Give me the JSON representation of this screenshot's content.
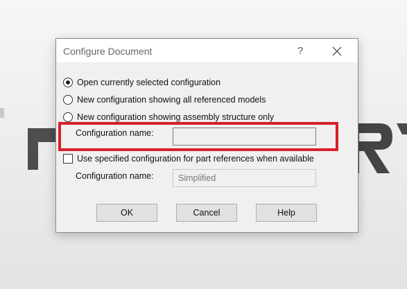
{
  "dialog": {
    "title": "Configure Document",
    "help_glyph": "?",
    "options": [
      {
        "label": "Open currently selected configuration",
        "selected": true
      },
      {
        "label": "New configuration showing all referenced models",
        "selected": false
      },
      {
        "label": "New configuration showing assembly structure only",
        "selected": false
      }
    ],
    "config_name_label": "Configuration name:",
    "config_name_value": "",
    "use_specified_label": "Use specified configuration for part references when available",
    "use_specified_checked": false,
    "specified_name_label": "Configuration name:",
    "specified_name_value": "Simplified",
    "buttons": {
      "ok": "OK",
      "cancel": "Cancel",
      "help": "Help"
    }
  },
  "colors": {
    "highlight": "#d81f26",
    "dialog_bg": "#f0f0f0"
  },
  "icons": [
    "close-icon",
    "help-icon"
  ]
}
